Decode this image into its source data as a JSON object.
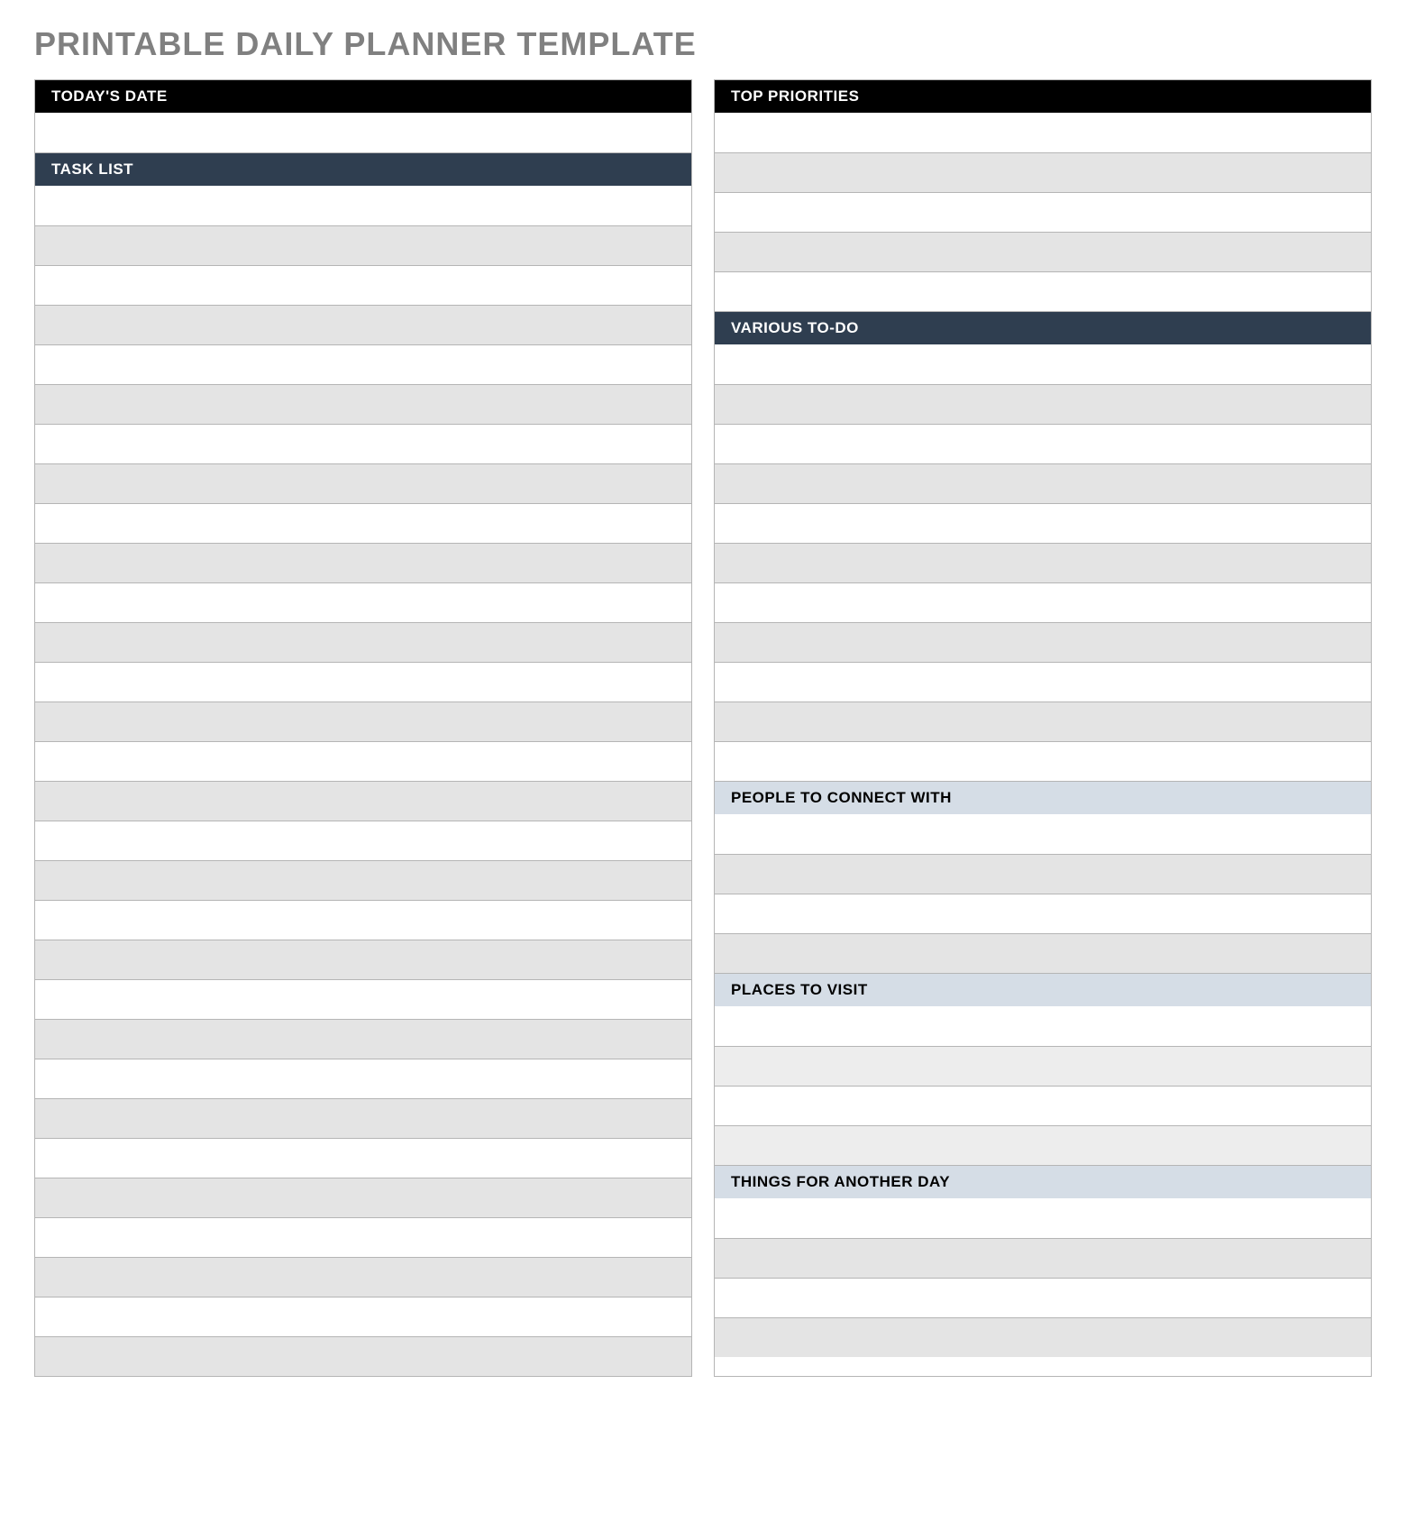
{
  "title": "PRINTABLE DAILY PLANNER TEMPLATE",
  "left": {
    "todays_date_label": "TODAY'S DATE",
    "task_list_label": "TASK LIST"
  },
  "right": {
    "top_priorities_label": "TOP PRIORITIES",
    "various_todo_label": "VARIOUS TO-DO",
    "people_label": "PEOPLE TO CONNECT WITH",
    "places_label": "PLACES TO VISIT",
    "things_label": "THINGS FOR ANOTHER DAY"
  }
}
